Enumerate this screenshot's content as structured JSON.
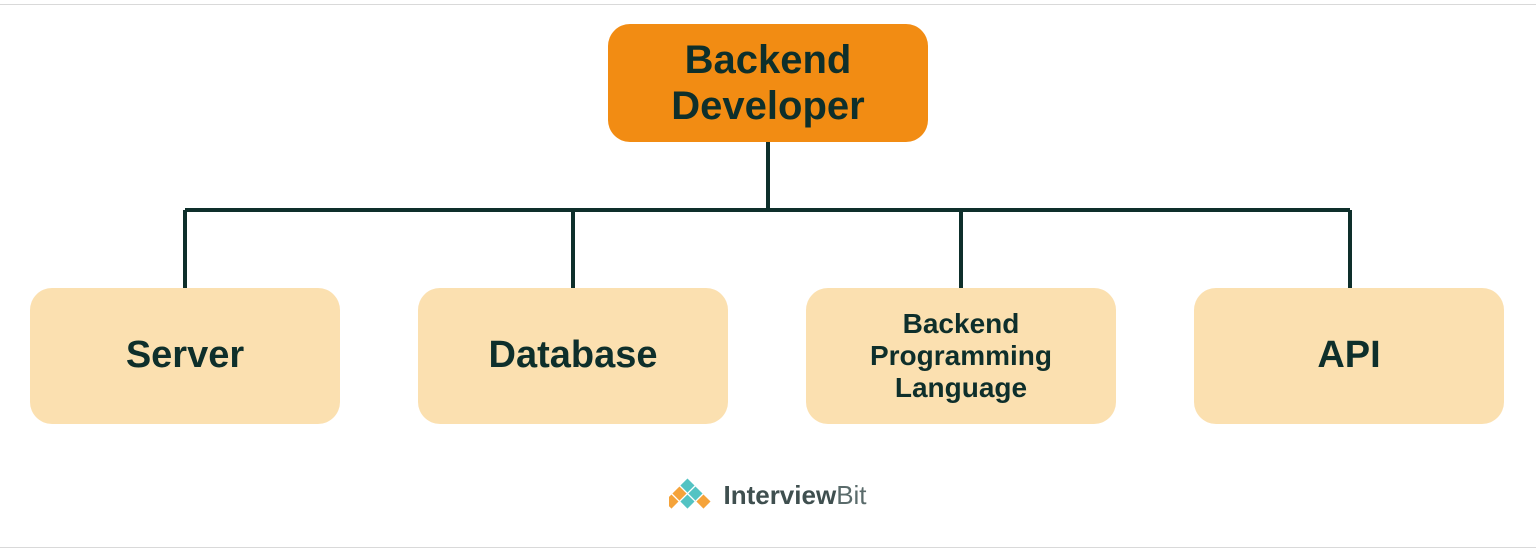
{
  "diagram": {
    "root": {
      "label": "Backend\nDeveloper"
    },
    "children": [
      {
        "label": "Server"
      },
      {
        "label": "Database"
      },
      {
        "label": "Backend\nProgramming\nLanguage"
      },
      {
        "label": "API"
      }
    ]
  },
  "footer": {
    "brand_bold": "Interview",
    "brand_light": "Bit"
  },
  "colors": {
    "root_bg": "#f28c13",
    "child_bg": "#fbe0b0",
    "line": "#0e2f2b"
  }
}
